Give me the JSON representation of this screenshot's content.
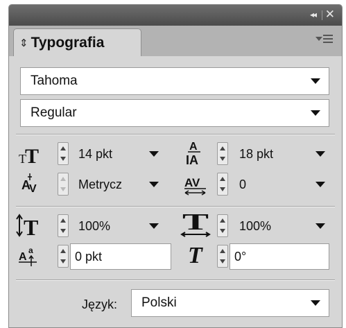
{
  "titlebar": {
    "collapse_icon": "double-chevron-right-icon",
    "collapse_glyph": "◂◂",
    "close_icon": "close-icon",
    "close_glyph": "✕"
  },
  "tab": {
    "arrows_glyph": "⇕",
    "label": "Typografia",
    "menu_icon": "panel-menu-icon"
  },
  "font_family": {
    "value": "Tahoma"
  },
  "font_style": {
    "value": "Regular"
  },
  "size": {
    "icon": "font-size-icon",
    "value": "14 pkt"
  },
  "leading": {
    "icon": "leading-icon",
    "value": "18 pkt"
  },
  "kerning": {
    "icon": "kerning-icon",
    "value": "Metrycz"
  },
  "tracking": {
    "icon": "tracking-icon",
    "value": "0"
  },
  "vertical_scale": {
    "icon": "vertical-scale-icon",
    "value": "100%"
  },
  "horizontal_scale": {
    "icon": "horizontal-scale-icon",
    "value": "100%"
  },
  "baseline_shift": {
    "icon": "baseline-shift-icon",
    "value": "0 pkt"
  },
  "skew": {
    "icon": "skew-icon",
    "value": "0°"
  },
  "language": {
    "label": "Język:",
    "value": "Polski"
  },
  "colors": {
    "titlebar": "#555555",
    "panel": "#d6d6d6",
    "tabstrip": "#b3b3b3"
  }
}
